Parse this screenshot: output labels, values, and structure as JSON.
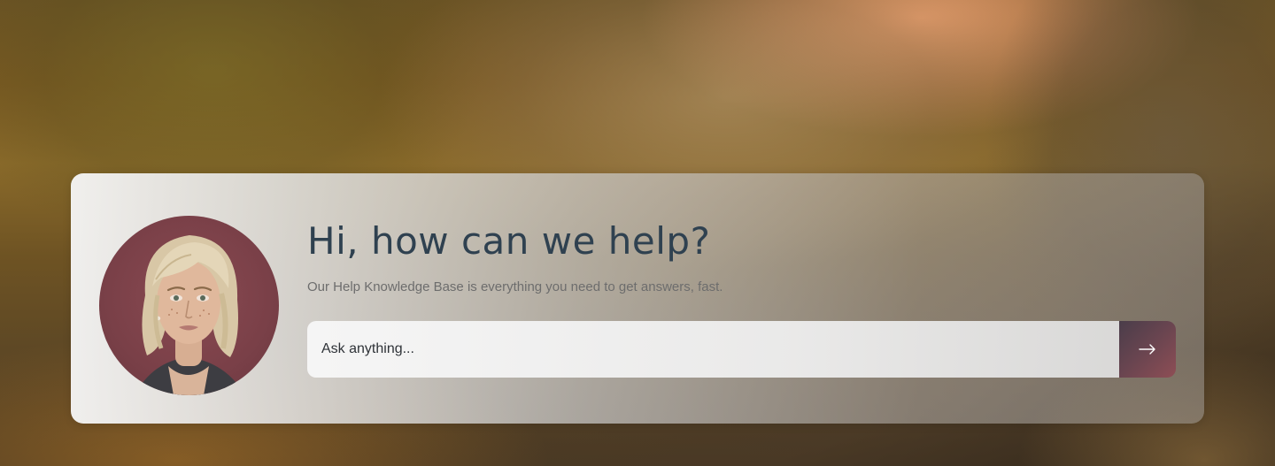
{
  "hero": {
    "heading": "Hi, how can we help?",
    "subtitle": "Our Help Knowledge Base is everything you need to get answers, fast."
  },
  "search": {
    "placeholder": "Ask anything...",
    "value": "",
    "submit_icon": "arrow-right-icon"
  },
  "avatar": {
    "icon": "woman-portrait"
  },
  "colors": {
    "heading": "#2f4150",
    "subtitle": "#6d6d6d",
    "search_button": "#7a4850",
    "avatar_bg": "#7a4048"
  }
}
